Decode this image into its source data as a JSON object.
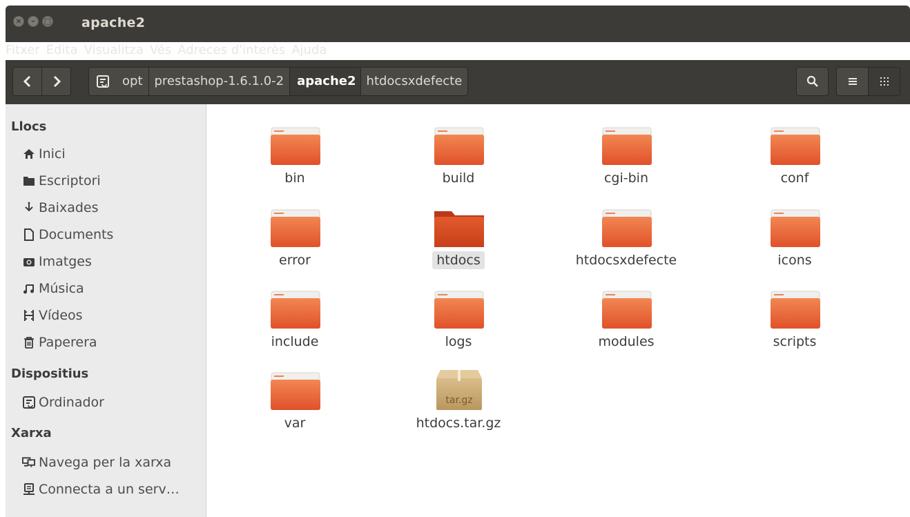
{
  "window": {
    "title": "apache2"
  },
  "menu": [
    "Fitxer",
    "Edita",
    "Visualitza",
    "Vés",
    "Adreces d'interès",
    "Ajuda"
  ],
  "toolbar": {
    "back_glyph": "<",
    "forward_glyph": ">",
    "breadcrumbs": [
      "opt",
      "prestashop-1.6.1.0-2",
      "apache2",
      "htdocsxdefecte"
    ],
    "active_crumb": "apache2"
  },
  "sidebar": {
    "sections": [
      {
        "title": "Llocs",
        "items": [
          {
            "label": "Inici",
            "icon": "home-icon"
          },
          {
            "label": "Escriptori",
            "icon": "desktop-folder-icon"
          },
          {
            "label": "Baixades",
            "icon": "download-icon"
          },
          {
            "label": "Documents",
            "icon": "document-icon"
          },
          {
            "label": "Imatges",
            "icon": "camera-icon"
          },
          {
            "label": "Música",
            "icon": "music-icon"
          },
          {
            "label": "Vídeos",
            "icon": "film-icon"
          },
          {
            "label": "Paperera",
            "icon": "trash-icon"
          }
        ]
      },
      {
        "title": "Dispositius",
        "items": [
          {
            "label": "Ordinador",
            "icon": "computer-icon"
          }
        ]
      },
      {
        "title": "Xarxa",
        "items": [
          {
            "label": "Navega per la xarxa",
            "icon": "network-icon"
          },
          {
            "label": "Connecta a un serv…",
            "icon": "server-icon"
          }
        ]
      }
    ]
  },
  "files": [
    {
      "name": "bin",
      "type": "folder"
    },
    {
      "name": "build",
      "type": "folder"
    },
    {
      "name": "cgi-bin",
      "type": "folder"
    },
    {
      "name": "conf",
      "type": "folder"
    },
    {
      "name": "error",
      "type": "folder"
    },
    {
      "name": "htdocs",
      "type": "folder",
      "selected": true
    },
    {
      "name": "htdocsxdefecte",
      "type": "folder"
    },
    {
      "name": "icons",
      "type": "folder"
    },
    {
      "name": "include",
      "type": "folder"
    },
    {
      "name": "logs",
      "type": "folder"
    },
    {
      "name": "modules",
      "type": "folder"
    },
    {
      "name": "scripts",
      "type": "folder"
    },
    {
      "name": "var",
      "type": "folder"
    },
    {
      "name": "htdocs.tar.gz",
      "type": "archive",
      "badge": "tar.gz"
    }
  ],
  "colors": {
    "folder_top": "#f28752",
    "folder_bottom": "#e0512a",
    "folder_selected_top": "#e25a2c",
    "folder_selected_bottom": "#c8401a",
    "titlebar": "#3c3b37",
    "sidebar_bg": "#ebebeb"
  }
}
